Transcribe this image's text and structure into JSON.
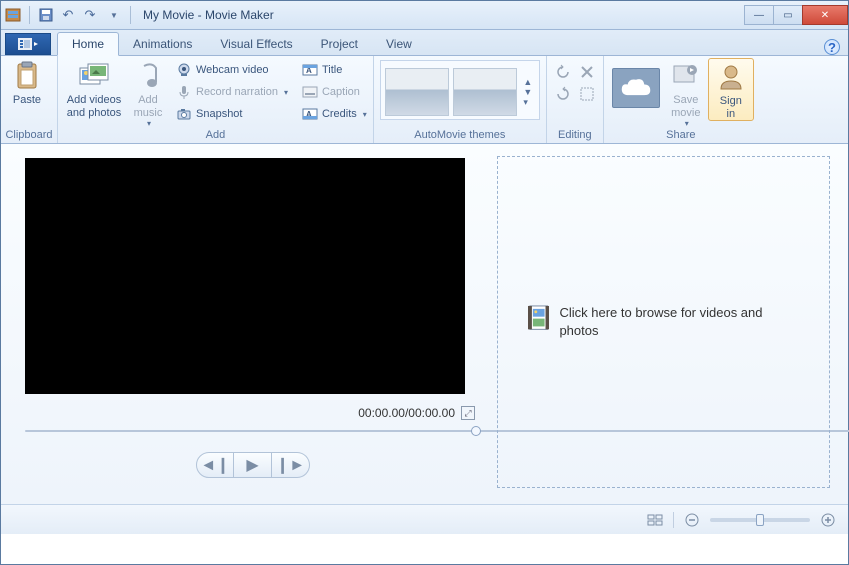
{
  "title": "My Movie - Movie Maker",
  "tabs": {
    "home": "Home",
    "animations": "Animations",
    "visual_effects": "Visual Effects",
    "project": "Project",
    "view": "View"
  },
  "ribbon": {
    "clipboard": {
      "label": "Clipboard",
      "paste": "Paste"
    },
    "add": {
      "label": "Add",
      "add_videos": "Add videos\nand photos",
      "add_music": "Add\nmusic",
      "webcam": "Webcam video",
      "narration": "Record narration",
      "snapshot": "Snapshot",
      "title": "Title",
      "caption": "Caption",
      "credits": "Credits"
    },
    "automovie": {
      "label": "AutoMovie themes"
    },
    "editing": {
      "label": "Editing"
    },
    "share": {
      "label": "Share",
      "save_movie": "Save\nmovie",
      "sign_in": "Sign\nin"
    }
  },
  "player": {
    "time": "00:00.00/00:00.00"
  },
  "drop": {
    "text": "Click here to browse for videos and photos"
  }
}
